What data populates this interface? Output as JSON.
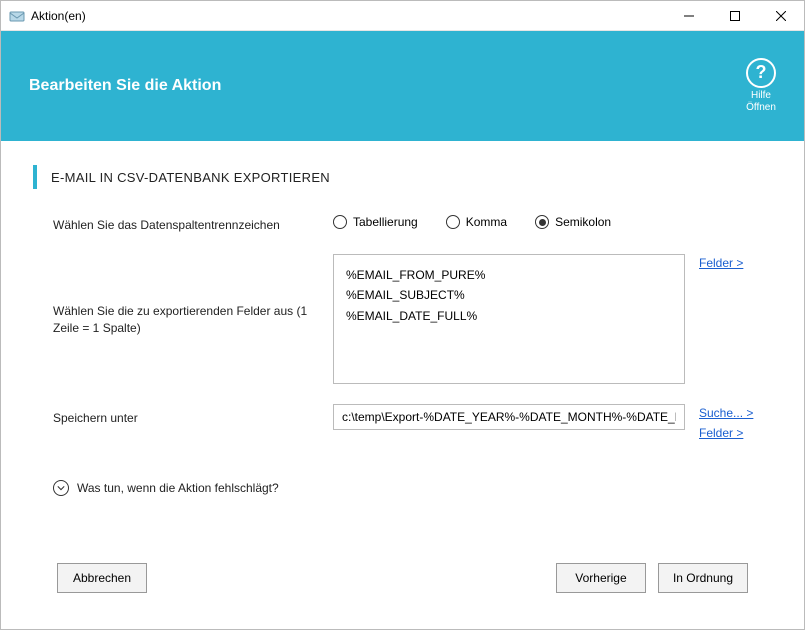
{
  "window": {
    "title": "Aktion(en)"
  },
  "header": {
    "title": "Bearbeiten Sie die Aktion",
    "help_line1": "Hilfe",
    "help_line2": "Öffnen"
  },
  "section": {
    "title": "E-MAIL IN CSV-DATENBANK EXPORTIEREN"
  },
  "delimiter": {
    "label": "Wählen Sie das Datenspaltentrennzeichen",
    "options": {
      "tab": "Tabellierung",
      "comma": "Komma",
      "semicolon": "Semikolon"
    },
    "selected": "semicolon"
  },
  "fields": {
    "label": "Wählen Sie die zu exportierenden Felder aus (1 Zeile = 1 Spalte)",
    "value": "%EMAIL_FROM_PURE%\n%EMAIL_SUBJECT%\n%EMAIL_DATE_FULL%",
    "link_fields": "Felder >"
  },
  "save": {
    "label": "Speichern unter",
    "value": "c:\\temp\\Export-%DATE_YEAR%-%DATE_MONTH%-%DATE_D",
    "link_search": "Suche... >",
    "link_fields": "Felder >"
  },
  "expander": {
    "label": "Was tun, wenn die Aktion fehlschlägt?"
  },
  "footer": {
    "cancel": "Abbrechen",
    "prev": "Vorherige",
    "ok": "In Ordnung"
  }
}
